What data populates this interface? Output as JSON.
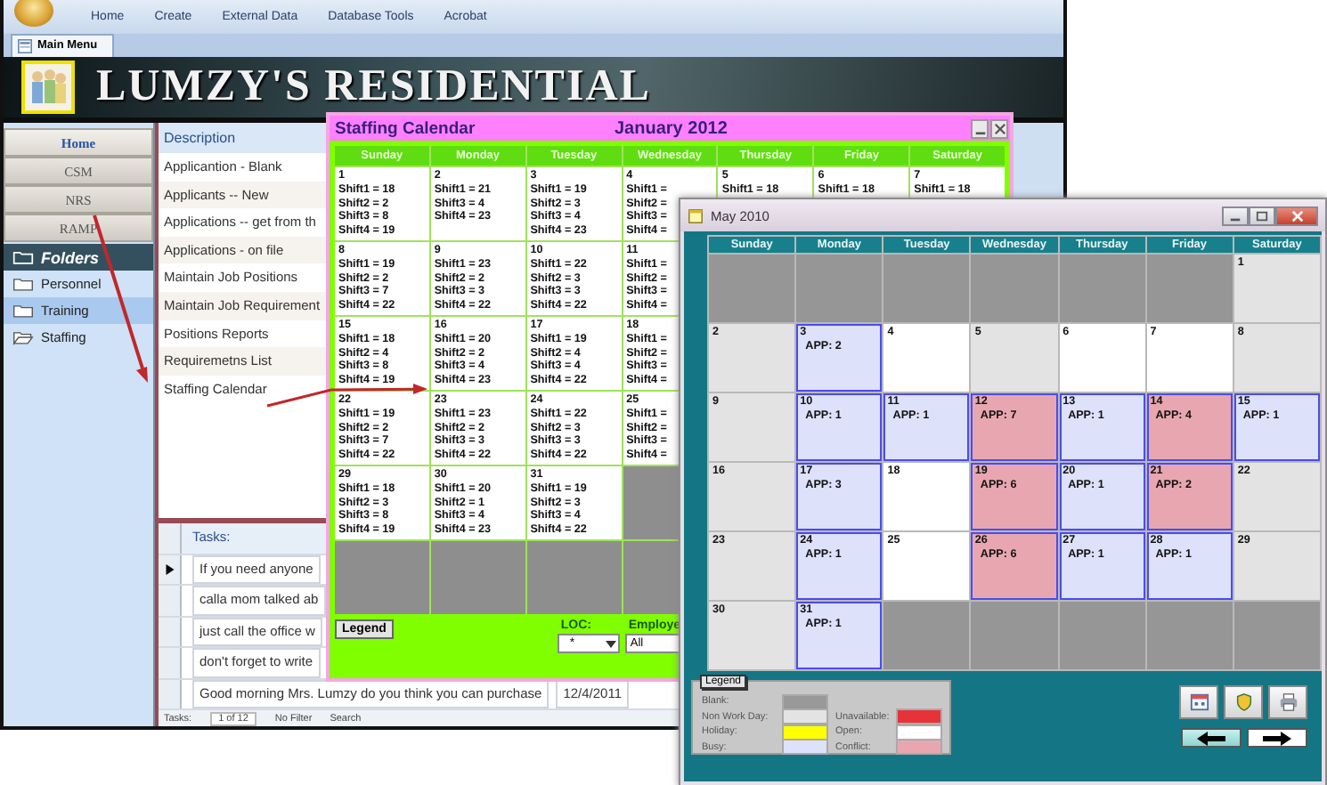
{
  "access_window": {
    "ribbon_tabs": [
      "Home",
      "Create",
      "External Data",
      "Database Tools",
      "Acrobat"
    ],
    "document_tab": "Main Menu",
    "banner_title": "LUMZY'S RESIDENTIAL",
    "nav_buttons": [
      {
        "label": "Home",
        "selected": true
      },
      {
        "label": "CSM",
        "selected": false
      },
      {
        "label": "NRS",
        "selected": false
      },
      {
        "label": "RAMP",
        "selected": false
      }
    ],
    "folders": {
      "title": "Folders",
      "items": [
        {
          "label": "Personnel",
          "selected": false,
          "expanded": false
        },
        {
          "label": "Training",
          "selected": true,
          "expanded": false
        },
        {
          "label": "Staffing",
          "selected": false,
          "expanded": true
        }
      ]
    },
    "description": {
      "header": "Description",
      "items": [
        "Applicantion - Blank",
        "Applicants -- New",
        "Applications -- get from th",
        "Applications - on file",
        "Maintain Job Positions",
        "Maintain Job Requirement",
        "Positions Reports",
        "Requiremetns List",
        "Staffing Calendar"
      ]
    },
    "tasks": {
      "header": "Tasks:",
      "rows": [
        {
          "text": "If you need anyone",
          "current": true
        },
        {
          "text": "calla mom talked ab",
          "current": false
        },
        {
          "text": "just call the office w",
          "current": false
        },
        {
          "text": "don't forget to write",
          "current": false
        },
        {
          "text": "Good morning Mrs. Lumzy do you think you can purchase",
          "date": "12/4/2011",
          "current": false
        }
      ]
    },
    "record_navigator": {
      "label": "Tasks:",
      "position": "1 of 12",
      "filter": "No Filter",
      "search": "Search"
    }
  },
  "staffing_calendar": {
    "title": "Staffing Calendar",
    "month": "January  2012",
    "weekdays": [
      "Sunday",
      "Monday",
      "Tuesday",
      "Wednesday",
      "Thursday",
      "Friday",
      "Saturday"
    ],
    "weeks": [
      [
        {
          "kind": "day",
          "day": "1",
          "shifts": [
            "Shift1 = 18",
            "Shift2 = 2",
            "Shift3 = 8",
            "Shift4 = 19"
          ]
        },
        {
          "kind": "day",
          "day": "2",
          "shifts": [
            "Shift1 = 21",
            "Shift3 = 4",
            "Shift4 = 23"
          ]
        },
        {
          "kind": "day",
          "day": "3",
          "shifts": [
            "Shift1 = 19",
            "Shift2 = 3",
            "Shift3 = 4",
            "Shift4 = 23"
          ]
        },
        {
          "kind": "day",
          "day": "4",
          "shifts": [
            "Shift1 =",
            "Shift2 =",
            "Shift3 =",
            "Shift4 ="
          ]
        },
        {
          "kind": "day",
          "day": "5",
          "shifts": [
            "Shift1 = 18"
          ]
        },
        {
          "kind": "day",
          "day": "6",
          "shifts": [
            "Shift1 = 18"
          ]
        },
        {
          "kind": "day",
          "day": "7",
          "shifts": [
            "Shift1 = 18"
          ]
        }
      ],
      [
        {
          "kind": "day",
          "day": "8",
          "shifts": [
            "Shift1 = 19",
            "Shift2 = 2",
            "Shift3 = 7",
            "Shift4 = 22"
          ]
        },
        {
          "kind": "day",
          "day": "9",
          "shifts": [
            "Shift1 = 23",
            "Shift2 = 2",
            "Shift3 = 3",
            "Shift4 = 22"
          ]
        },
        {
          "kind": "day",
          "day": "10",
          "shifts": [
            "Shift1 = 22",
            "Shift2 = 3",
            "Shift3 = 3",
            "Shift4 = 22"
          ]
        },
        {
          "kind": "day",
          "day": "11",
          "shifts": [
            "Shift1 =",
            "Shift2 =",
            "Shift3 =",
            "Shift4 ="
          ]
        }
      ],
      [
        {
          "kind": "day",
          "day": "15",
          "shifts": [
            "Shift1 = 18",
            "Shift2 = 4",
            "Shift3 = 8",
            "Shift4 = 19"
          ]
        },
        {
          "kind": "day",
          "day": "16",
          "shifts": [
            "Shift1 = 20",
            "Shift2 = 2",
            "Shift3 = 4",
            "Shift4 = 23"
          ]
        },
        {
          "kind": "day",
          "day": "17",
          "shifts": [
            "Shift1 = 19",
            "Shift2 = 4",
            "Shift3 = 4",
            "Shift4 = 22"
          ]
        },
        {
          "kind": "day",
          "day": "18",
          "shifts": [
            "Shift1 =",
            "Shift2 =",
            "Shift3 =",
            "Shift4 ="
          ]
        }
      ],
      [
        {
          "kind": "day",
          "day": "22",
          "shifts": [
            "Shift1 = 19",
            "Shift2 = 2",
            "Shift3 = 7",
            "Shift4 = 22"
          ]
        },
        {
          "kind": "day",
          "day": "23",
          "shifts": [
            "Shift1 = 23",
            "Shift2 = 2",
            "Shift3 = 3",
            "Shift4 = 22"
          ]
        },
        {
          "kind": "day",
          "day": "24",
          "shifts": [
            "Shift1 = 22",
            "Shift2 = 3",
            "Shift3 = 3",
            "Shift4 = 22"
          ]
        },
        {
          "kind": "day",
          "day": "25",
          "shifts": [
            "Shift1 =",
            "Shift2 =",
            "Shift3 =",
            "Shift4 ="
          ]
        }
      ],
      [
        {
          "kind": "day",
          "day": "29",
          "shifts": [
            "Shift1 = 18",
            "Shift2 = 3",
            "Shift3 = 8",
            "Shift4 = 19"
          ]
        },
        {
          "kind": "day",
          "day": "30",
          "shifts": [
            "Shift1 = 20",
            "Shift2 = 1",
            "Shift3 = 4",
            "Shift4 = 23"
          ]
        },
        {
          "kind": "day",
          "day": "31",
          "shifts": [
            "Shift1 = 19",
            "Shift2 = 3",
            "Shift3 = 4",
            "Shift4 = 22"
          ]
        },
        {
          "kind": "blank"
        }
      ],
      [
        {
          "kind": "blank"
        },
        {
          "kind": "blank"
        },
        {
          "kind": "blank"
        },
        {
          "kind": "blank"
        }
      ]
    ],
    "legend_button": "Legend",
    "loc_label": "LOC:",
    "loc_value": "*",
    "employee_label": "Employe",
    "employee_value": "All"
  },
  "may_calendar": {
    "title": "May  2010",
    "weekdays": [
      "Sunday",
      "Monday",
      "Tuesday",
      "Wednesday",
      "Thursday",
      "Friday",
      "Saturday"
    ],
    "weeks": [
      [
        {
          "kind": "blank"
        },
        {
          "kind": "blank"
        },
        {
          "kind": "blank"
        },
        {
          "kind": "blank"
        },
        {
          "kind": "blank"
        },
        {
          "kind": "blank"
        },
        {
          "kind": "nonwork",
          "day": "1"
        }
      ],
      [
        {
          "kind": "nonwork",
          "day": "2"
        },
        {
          "kind": "busy",
          "day": "3",
          "text": "APP: 2"
        },
        {
          "kind": "open",
          "day": "4"
        },
        {
          "kind": "nonwork",
          "day": "5"
        },
        {
          "kind": "open",
          "day": "6"
        },
        {
          "kind": "open",
          "day": "7"
        },
        {
          "kind": "nonwork",
          "day": "8"
        }
      ],
      [
        {
          "kind": "nonwork",
          "day": "9"
        },
        {
          "kind": "busy",
          "day": "10",
          "text": "APP: 1"
        },
        {
          "kind": "busy",
          "day": "11",
          "text": "APP: 1"
        },
        {
          "kind": "conflict",
          "day": "12",
          "text": "APP: 7"
        },
        {
          "kind": "busy",
          "day": "13",
          "text": "APP: 1"
        },
        {
          "kind": "conflict",
          "day": "14",
          "text": "APP: 4"
        },
        {
          "kind": "busy",
          "day": "15",
          "text": "APP: 1"
        }
      ],
      [
        {
          "kind": "nonwork",
          "day": "16"
        },
        {
          "kind": "busy",
          "day": "17",
          "text": "APP: 3"
        },
        {
          "kind": "open",
          "day": "18"
        },
        {
          "kind": "conflict",
          "day": "19",
          "text": "APP: 6"
        },
        {
          "kind": "busy",
          "day": "20",
          "text": "APP: 1"
        },
        {
          "kind": "conflict",
          "day": "21",
          "text": "APP: 2"
        },
        {
          "kind": "nonwork",
          "day": "22"
        }
      ],
      [
        {
          "kind": "nonwork",
          "day": "23"
        },
        {
          "kind": "busy",
          "day": "24",
          "text": "APP: 1"
        },
        {
          "kind": "open",
          "day": "25"
        },
        {
          "kind": "conflict",
          "day": "26",
          "text": "APP: 6"
        },
        {
          "kind": "busy",
          "day": "27",
          "text": "APP: 1"
        },
        {
          "kind": "busy",
          "day": "28",
          "text": "APP: 1"
        },
        {
          "kind": "nonwork",
          "day": "29"
        }
      ],
      [
        {
          "kind": "nonwork",
          "day": "30"
        },
        {
          "kind": "busy",
          "day": "31",
          "text": "APP: 1"
        },
        {
          "kind": "blank"
        },
        {
          "kind": "blank"
        },
        {
          "kind": "blank"
        },
        {
          "kind": "blank"
        },
        {
          "kind": "blank"
        }
      ]
    ],
    "legend": {
      "title": "Legend",
      "left": [
        {
          "label": "Blank:",
          "color": "#999999"
        },
        {
          "label": "Non Work Day:",
          "color": "#e3e3e3"
        },
        {
          "label": "Holiday:",
          "color": "#ffff00"
        },
        {
          "label": "Busy:",
          "color": "#dde1fa"
        }
      ],
      "right": [
        {
          "label": "Unavailable:",
          "color": "#e8323a"
        },
        {
          "label": "Open:",
          "color": "#ffffff"
        },
        {
          "label": "Conflict:",
          "color": "#e8a7b0"
        }
      ]
    }
  }
}
